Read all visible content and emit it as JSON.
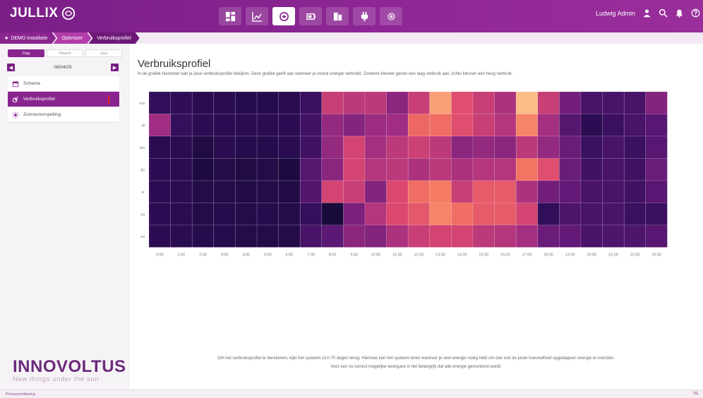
{
  "app": {
    "logo_text": "JULLIX",
    "user_name": "Ludwig Admin",
    "colors": {
      "topbar": "#8e2795",
      "accent": "#8a2590",
      "breadcrumb": "#b23ca9"
    }
  },
  "nav": {
    "icons": [
      "dashboard-icon",
      "chart-icon",
      "optimize-icon",
      "battery-icon",
      "device-icon",
      "plug-icon",
      "gear-icon"
    ],
    "active_index": 2
  },
  "breadcrumb": {
    "items": [
      "DEMO installatie",
      "Optimizer",
      "Verbruiksprofiel"
    ]
  },
  "sidebar": {
    "period_tabs": [
      "Dag",
      "Maand",
      "Jaar"
    ],
    "active_period": 0,
    "date": "09/04/25",
    "prev": "◀",
    "next": "▶",
    "menu": [
      {
        "label": "Schema",
        "icon": "calendar-icon"
      },
      {
        "label": "Verbruiksprofiel",
        "icon": "usage-profile-icon"
      },
      {
        "label": "Zonnevoorspelling",
        "icon": "sun-icon"
      }
    ],
    "active_menu": 1,
    "brand_name": "INNOVOLTUS",
    "brand_tagline": "New things under the sun"
  },
  "main": {
    "title": "Verbruiksprofiel",
    "subtitle": "In de grafiek hieronder kan je jouw verbruiksprofiel bekijken. Deze grafiek geeft aan wanneer je vooral energie verbruikt. Donkere kleuren geven een laag verbruik aan, lichte kleuren een hoog verbruik.",
    "footnote_line1": "Om het verbruiksprofiel te berekenen, kijkt het systeem zo'n 70 dagen terug. Hiermee kan het systeem leren wanneer je veel energie nodig hebt om dan ook de juiste hoeveelheid opgedageen energie te voorzien.",
    "footnote_line2": "Voor een zo correct mogelijke weergave is het belangrijk dat alle energie gemonitord wordt."
  },
  "status": {
    "left": "Privacyverklaring",
    "right": "NL"
  },
  "chart_data": {
    "type": "heatmap",
    "title": "",
    "x": [
      "0:00",
      "1:00",
      "2:00",
      "3:00",
      "4:00",
      "5:00",
      "6:00",
      "7:00",
      "8:00",
      "9:00",
      "10:00",
      "11:00",
      "12:00",
      "13:00",
      "14:00",
      "15:00",
      "16:00",
      "17:00",
      "18:00",
      "19:00",
      "20:00",
      "21:00",
      "22:00",
      "23:00"
    ],
    "y": [
      "ma",
      "di",
      "wo",
      "do",
      "vr",
      "za",
      "zo"
    ],
    "values": [
      [
        0.15,
        0.14,
        0.12,
        0.12,
        0.11,
        0.11,
        0.12,
        0.18,
        0.55,
        0.52,
        0.52,
        0.4,
        0.55,
        0.85,
        0.62,
        0.55,
        0.48,
        0.92,
        0.55,
        0.34,
        0.22,
        0.22,
        0.22,
        0.38
      ],
      [
        0.45,
        0.16,
        0.13,
        0.13,
        0.12,
        0.12,
        0.13,
        0.2,
        0.42,
        0.38,
        0.44,
        0.45,
        0.7,
        0.72,
        0.62,
        0.55,
        0.5,
        0.78,
        0.46,
        0.26,
        0.13,
        0.18,
        0.22,
        0.27
      ],
      [
        0.12,
        0.12,
        0.08,
        0.12,
        0.11,
        0.11,
        0.12,
        0.2,
        0.42,
        0.58,
        0.46,
        0.52,
        0.56,
        0.52,
        0.4,
        0.42,
        0.4,
        0.52,
        0.42,
        0.32,
        0.18,
        0.22,
        0.18,
        0.27
      ],
      [
        0.13,
        0.12,
        0.07,
        0.1,
        0.08,
        0.1,
        0.07,
        0.26,
        0.4,
        0.58,
        0.5,
        0.52,
        0.48,
        0.52,
        0.48,
        0.5,
        0.5,
        0.74,
        0.62,
        0.32,
        0.2,
        0.22,
        0.2,
        0.32
      ],
      [
        0.13,
        0.12,
        0.1,
        0.1,
        0.09,
        0.1,
        0.09,
        0.25,
        0.58,
        0.55,
        0.38,
        0.6,
        0.72,
        0.76,
        0.55,
        0.66,
        0.66,
        0.48,
        0.34,
        0.3,
        0.22,
        0.22,
        0.2,
        0.27
      ],
      [
        0.13,
        0.12,
        0.1,
        0.11,
        0.1,
        0.11,
        0.1,
        0.16,
        0.05,
        0.36,
        0.5,
        0.6,
        0.65,
        0.78,
        0.72,
        0.66,
        0.66,
        0.58,
        0.15,
        0.24,
        0.22,
        0.22,
        0.18,
        0.18
      ],
      [
        0.13,
        0.12,
        0.11,
        0.11,
        0.1,
        0.1,
        0.1,
        0.22,
        0.28,
        0.4,
        0.38,
        0.48,
        0.55,
        0.58,
        0.58,
        0.52,
        0.5,
        0.46,
        0.32,
        0.3,
        0.22,
        0.24,
        0.24,
        0.27
      ]
    ],
    "color_scale": "magma",
    "legend": "none",
    "grid": false
  }
}
